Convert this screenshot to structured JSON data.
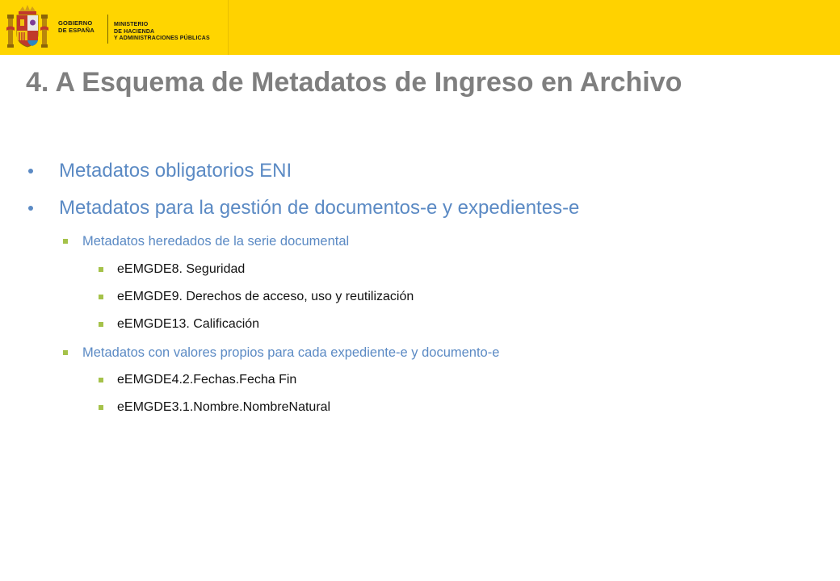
{
  "header": {
    "gov_line1": "GOBIERNO",
    "gov_line2": "DE ESPAÑA",
    "ministry_line1": "MINISTERIO",
    "ministry_line2": "DE HACIENDA",
    "ministry_line3": "Y ADMINISTRACIONES PÚBLICAS",
    "bar_color": "#ffd200",
    "coat_icon": "coat-of-arms-spain"
  },
  "slide": {
    "title": "4. A Esquema de Metadatos de Ingreso en Archivo",
    "title_color": "#7f7f7f",
    "accent_color": "#5b8ac4",
    "bullet_color": "#a5c24a",
    "items": [
      {
        "level": 1,
        "text": "Metadatos obligatorios ENI"
      },
      {
        "level": 1,
        "text": "Metadatos para la gestión de documentos-e y expedientes-e"
      },
      {
        "level": 2,
        "text": "Metadatos heredados de la serie documental"
      },
      {
        "level": 3,
        "text": "eEMGDE8. Seguridad"
      },
      {
        "level": 3,
        "text": "eEMGDE9. Derechos de acceso, uso y reutilización"
      },
      {
        "level": 3,
        "text": "eEMGDE13. Calificación"
      },
      {
        "level": 2,
        "text": "Metadatos con valores propios para cada expediente-e y documento-e"
      },
      {
        "level": 3,
        "text": "eEMGDE4.2.Fechas.Fecha Fin"
      },
      {
        "level": 3,
        "text": "eEMGDE3.1.Nombre.NombreNatural"
      }
    ]
  }
}
